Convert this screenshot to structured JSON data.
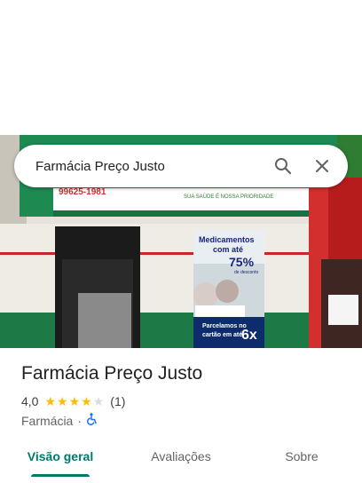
{
  "search": {
    "query": "Farmácia Preço Justo"
  },
  "photo": {
    "sign_phone": "99625-1981",
    "sign_slogan": "SUA SAÚDE É NOSSA PRIORIDADE",
    "poster_headline_1": "Medicamentos",
    "poster_headline_2": "com até",
    "poster_discount": "75%",
    "poster_small": "de desconto",
    "poster_footer_1": "Parcelamos no",
    "poster_footer_2": "cartão em até",
    "poster_installments": "6x"
  },
  "place": {
    "name": "Farmácia Preço Justo",
    "rating": "4,0",
    "rating_value": 4,
    "rating_max": 5,
    "review_count": "(1)",
    "category": "Farmácia",
    "separator": "·"
  },
  "tabs": [
    {
      "label": "Visão geral",
      "active": true
    },
    {
      "label": "Avaliações",
      "active": false
    },
    {
      "label": "Sobre",
      "active": false
    }
  ],
  "colors": {
    "accent": "#00796b",
    "star": "#fbbc04",
    "accessibility": "#1a73e8"
  }
}
